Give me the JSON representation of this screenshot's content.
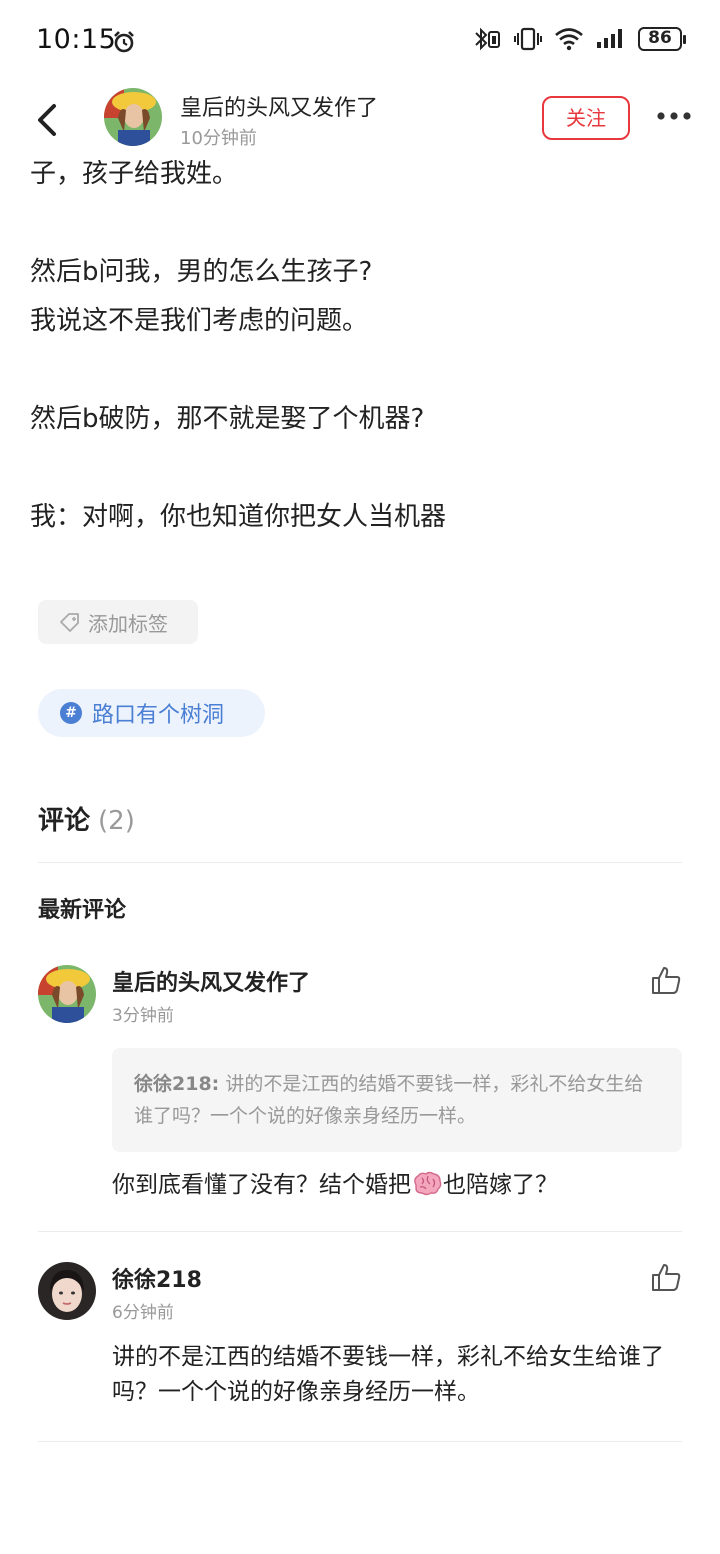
{
  "status_bar": {
    "time": "10:15",
    "battery": "86",
    "icons": [
      "alarm-icon",
      "bluetooth-icon",
      "vibrate-icon",
      "wifi-icon",
      "signal-icon",
      "battery-icon"
    ]
  },
  "header": {
    "author_name": "皇后的头风又发作了",
    "time": "10分钟前",
    "follow_label": "关注"
  },
  "post": {
    "lines": [
      "子，孩子给我姓。",
      "",
      "然后b问我，男的怎么生孩子?",
      "我说这不是我们考虑的问题。",
      "",
      "然后b破防，那不就是娶了个机器?",
      "",
      "我：对啊，你也知道你把女人当机器"
    ],
    "add_tag_label": "添加标签",
    "topic": "路口有个树洞"
  },
  "comments": {
    "title": "评论",
    "count": "(2)",
    "latest_label": "最新评论",
    "items": [
      {
        "name": "皇后的头风又发作了",
        "time": "3分钟前",
        "quote_author": "徐徐218:",
        "quote_text": "讲的不是江西的结婚不要钱一样，彩礼不给女生给谁了吗？一个个说的好像亲身经历一样。",
        "text_before": "你到底看懂了没有？结个婚把",
        "emoji": "brain-emoji",
        "text_after": "也陪嫁了？"
      },
      {
        "name": "徐徐218",
        "time": "6分钟前",
        "text": "讲的不是江西的结婚不要钱一样，彩礼不给女生给谁了吗？一个个说的好像亲身经历一样。"
      }
    ]
  },
  "colors": {
    "accent_red": "#e8383d",
    "topic_blue": "#4a7fd4",
    "muted_gray": "#999999"
  }
}
